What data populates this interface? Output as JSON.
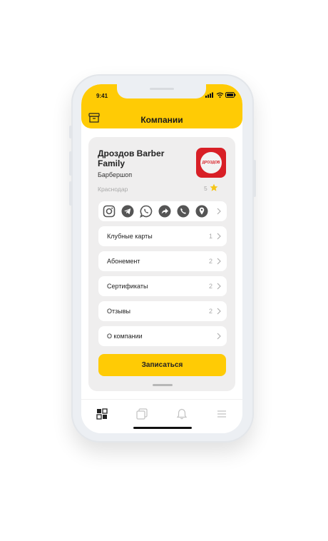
{
  "status_bar": {
    "time": "9:41"
  },
  "header": {
    "title": "Компании",
    "archive_icon": "archive-box-icon"
  },
  "company": {
    "name": "Дроздов Barber Family",
    "category": "Барбершоп",
    "city": "Краснодар",
    "rating": "5",
    "logo_text": "ДРОЗДОВ"
  },
  "social_row": {
    "icons": [
      "instagram-icon",
      "telegram-icon",
      "whatsapp-icon",
      "share-icon",
      "phone-icon",
      "location-pin-icon"
    ]
  },
  "menu": [
    {
      "label": "Клубные карты",
      "count": "1"
    },
    {
      "label": "Абонемент",
      "count": "2"
    },
    {
      "label": "Сертификаты",
      "count": "2"
    },
    {
      "label": "Отзывы",
      "count": "2"
    },
    {
      "label": "О компании",
      "count": ""
    }
  ],
  "book_button": {
    "label": "Записаться"
  },
  "tabbar": {
    "tabs": [
      "dashboard-icon",
      "cards-icon",
      "bell-icon",
      "menu-icon"
    ]
  },
  "colors": {
    "accent": "#ffcb05",
    "card_bg": "#efeeee",
    "logo_red": "#d81f26",
    "star": "#f5c518"
  }
}
